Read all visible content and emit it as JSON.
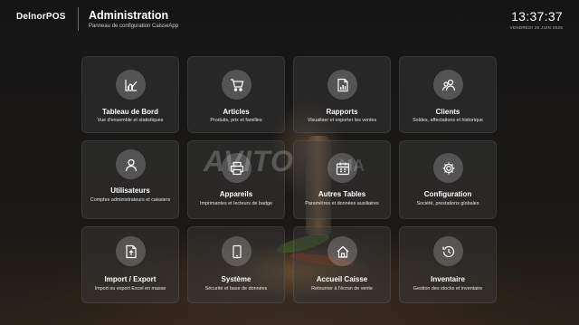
{
  "header": {
    "logo": "DelnorPOS",
    "title": "Administration",
    "subtitle": "Panneau de configuration CaisseApp",
    "time": "13:37:37",
    "date": "VENDREDI 26 JUIN 2026"
  },
  "watermark": {
    "main": "AVITO",
    "sub": "MA"
  },
  "tiles": [
    {
      "label": "Tableau de Bord",
      "desc": "Vue d'ensemble et statistiques",
      "icon": "chart-icon"
    },
    {
      "label": "Articles",
      "desc": "Produits, prix et familles",
      "icon": "cart-icon"
    },
    {
      "label": "Rapports",
      "desc": "Visualiser et exporter les ventes",
      "icon": "report-icon"
    },
    {
      "label": "Clients",
      "desc": "Soldes, affectations et historique",
      "icon": "clients-icon"
    },
    {
      "label": "Utilisateurs",
      "desc": "Comptes administrateurs et caissiers",
      "icon": "user-icon"
    },
    {
      "label": "Appareils",
      "desc": "Imprimantes et lecteurs de badge",
      "icon": "printer-icon"
    },
    {
      "label": "Autres Tables",
      "desc": "Paramètres et données auxiliaires",
      "icon": "calendar-icon"
    },
    {
      "label": "Configuration",
      "desc": "Société, prestations globales",
      "icon": "gear-icon"
    },
    {
      "label": "Import / Export",
      "desc": "Import ou export Excel en masse",
      "icon": "file-import-icon"
    },
    {
      "label": "Système",
      "desc": "Sécurité et base de données",
      "icon": "tablet-icon"
    },
    {
      "label": "Accueil Caisse",
      "desc": "Retourner à l'écran de vente",
      "icon": "home-icon"
    },
    {
      "label": "Inventaire",
      "desc": "Gestion des stocks et inventaire",
      "icon": "history-icon"
    }
  ]
}
